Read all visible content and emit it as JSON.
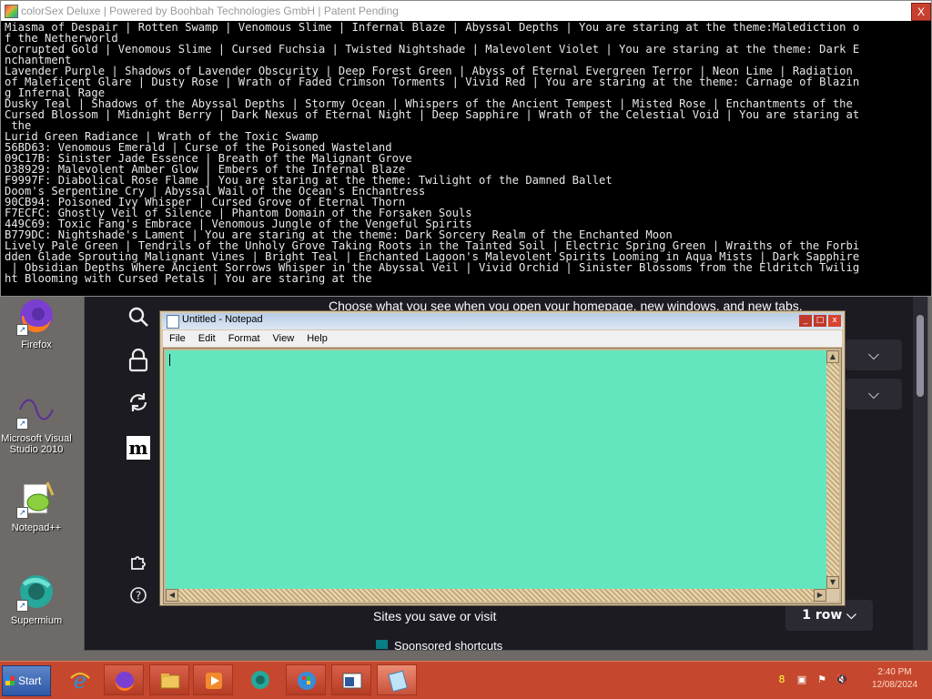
{
  "console": {
    "title": "colorSex Deluxe | Powered by Boohbah Technologies GmbH | Patent Pending",
    "close_label": "X",
    "lines": [
      "Miasma of Despair | Rotten Swamp | Venomous Slime | Infernal Blaze | Abyssal Depths | You are staring at the theme:Malediction o",
      "f the Netherworld",
      "Corrupted Gold | Venomous Slime | Cursed Fuchsia | Twisted Nightshade | Malevolent Violet | You are staring at the theme: Dark E",
      "nchantment",
      "Lavender Purple | Shadows of Lavender Obscurity | Deep Forest Green | Abyss of Eternal Evergreen Terror | Neon Lime | Radiation",
      "of Maleficent Glare | Dusty Rose | Wrath of Faded Crimson Torments | Vivid Red | You are staring at the theme: Carnage of Blazin",
      "g Infernal Rage",
      "Dusky Teal | Shadows of the Abyssal Depths | Stormy Ocean | Whispers of the Ancient Tempest | Misted Rose | Enchantments of the",
      "Cursed Blossom | Midnight Berry | Dark Nexus of Eternal Night | Deep Sapphire | Wrath of the Celestial Void | You are staring at",
      " the",
      "Lurid Green Radiance | Wrath of the Toxic Swamp",
      "56BD63: Venomous Emerald | Curse of the Poisoned Wasteland",
      "09C17B: Sinister Jade Essence | Breath of the Malignant Grove",
      "D38929: Malevolent Amber Glow | Embers of the Infernal Blaze",
      "F9997F: Diabolical Rose Flame | You are staring at the theme: Twilight of the Damned Ballet",
      "Doom's Serpentine Cry | Abyssal Wail of the Ocean's Enchantress",
      "90CB94: Poisoned Ivy Whisper | Cursed Grove of Eternal Thorn",
      "F7ECFC: Ghostly Veil of Silence | Phantom Domain of the Forsaken Souls",
      "449C69: Toxic Fang's Embrace | Venomous Jungle of the Vengeful Spirits",
      "B779DC: Nightshade's Lament | You are staring at the theme: Dark Sorcery Realm of the Enchanted Moon",
      "Lively Pale Green | Tendrils of the Unholy Grove Taking Roots in the Tainted Soil | Electric Spring Green | Wraiths of the Forbi",
      "dden Glade Sprouting Malignant Vines | Bright Teal | Enchanted Lagoon's Malevolent Spirits Looming in Aqua Mists | Dark Sapphire",
      " | Obsidian Depths Where Ancient Sorrows Whisper in the Abyssal Veil | Vivid Orchid | Sinister Blossoms from the Eldritch Twilig",
      "ht Blooming with Cursed Petals | You are staring at the"
    ]
  },
  "browser": {
    "header_text": "Choose what you see when you open your homepage, new windows, and new tabs.",
    "sites_label": "Sites you save or visit",
    "rows_value": "1 row",
    "sponsored_label": "Sponsored shortcuts",
    "sidebar_icons": [
      "search-icon",
      "lock-icon",
      "sync-icon",
      "mozilla-logo",
      "extensions-icon",
      "help-icon"
    ]
  },
  "notepad": {
    "title": "Untitled - Notepad",
    "menu": [
      "File",
      "Edit",
      "Format",
      "View",
      "Help"
    ],
    "text": "",
    "background": "#63e6be"
  },
  "desktop_icons": [
    {
      "label": "Firefox",
      "icon": "firefox-icon"
    },
    {
      "label": "Microsoft Visual Studio 2010",
      "icon": "visual-studio-icon"
    },
    {
      "label": "Notepad++",
      "icon": "notepadpp-icon"
    },
    {
      "label": "Supermium",
      "icon": "supermium-icon"
    }
  ],
  "taskbar": {
    "start_label": "Start",
    "clock_time": "2:40 PM",
    "clock_date": "12/08/2024",
    "color": "#c5482e",
    "apps": [
      "internet-explorer-icon",
      "firefox-icon",
      "file-explorer-icon",
      "media-player-icon",
      "supermium-icon",
      "windows-update-icon",
      "console-icon",
      "notepad-icon"
    ]
  }
}
